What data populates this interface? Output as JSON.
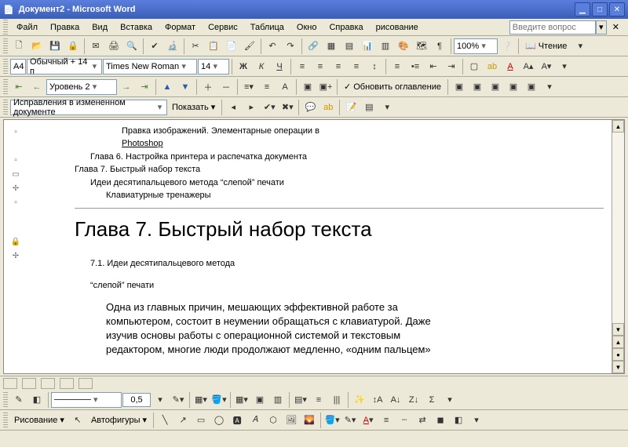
{
  "title": "Документ2 - Microsoft Word",
  "menu": [
    "Файл",
    "Правка",
    "Вид",
    "Вставка",
    "Формат",
    "Сервис",
    "Таблица",
    "Окно",
    "Справка",
    "рисование"
  ],
  "ask_placeholder": "Введите вопрос",
  "format": {
    "style_prefix": "A4",
    "style": "Обычный + 14 п",
    "font": "Times New Roman",
    "size": "14",
    "zoom": "100%",
    "reading": "Чтение",
    "bold": "Ж",
    "italic": "К",
    "underline": "Ч"
  },
  "outline": {
    "level": "Уровень 2",
    "update": "Обновить оглавление"
  },
  "review": {
    "mode": "Исправления в измененном документе",
    "show": "Показать"
  },
  "draw": {
    "label": "Рисование",
    "autoshapes": "Автофигуры",
    "line_weight": "0,5"
  },
  "doc": {
    "o1": "Правка изображений. Элементарные операции в",
    "o1b": "Photoshop",
    "o2": "Глава 6. Настройка принтера и распечатка документа",
    "o3": "Глава 7. Быстрый набор текста",
    "o4": "Идеи десятипальцевого метода “слепой” печати",
    "o5": "Клавиатурные тренажеры",
    "h1": "Глава 7. Быстрый набор текста",
    "h2a": "7.1. Идеи десятипальцевого метода",
    "h2b": "“слепой” печати",
    "body": "Одна из главных причин, мешающих эффективной работе за компьютером, состоит в неумении обращаться с клавиатурой. Даже изучив основы работы с операционной системой и текстовым редактором, многие люди продолжают медленно, «одним пальцем»"
  }
}
